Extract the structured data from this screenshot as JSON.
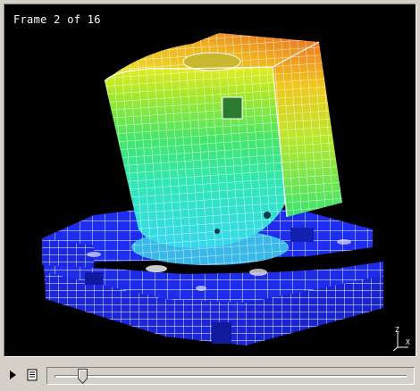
{
  "viewer": {
    "frame_label": "Frame 2 of 16",
    "frame_current": 2,
    "frame_total": 16,
    "axis_labels": {
      "z": "Z",
      "x": "X"
    }
  },
  "controls": {
    "play_icon": "play-icon",
    "options_icon": "document-icon",
    "slider_value_fraction": 0.0667
  },
  "colors": {
    "background": "#000000",
    "mesh_lines": "#ffffff",
    "base_blue": "#1e2ef0",
    "contour_low": "#2ec9e8",
    "contour_mid": "#3fe07a",
    "contour_high_mid": "#c8e020",
    "contour_high": "#e8742a"
  }
}
